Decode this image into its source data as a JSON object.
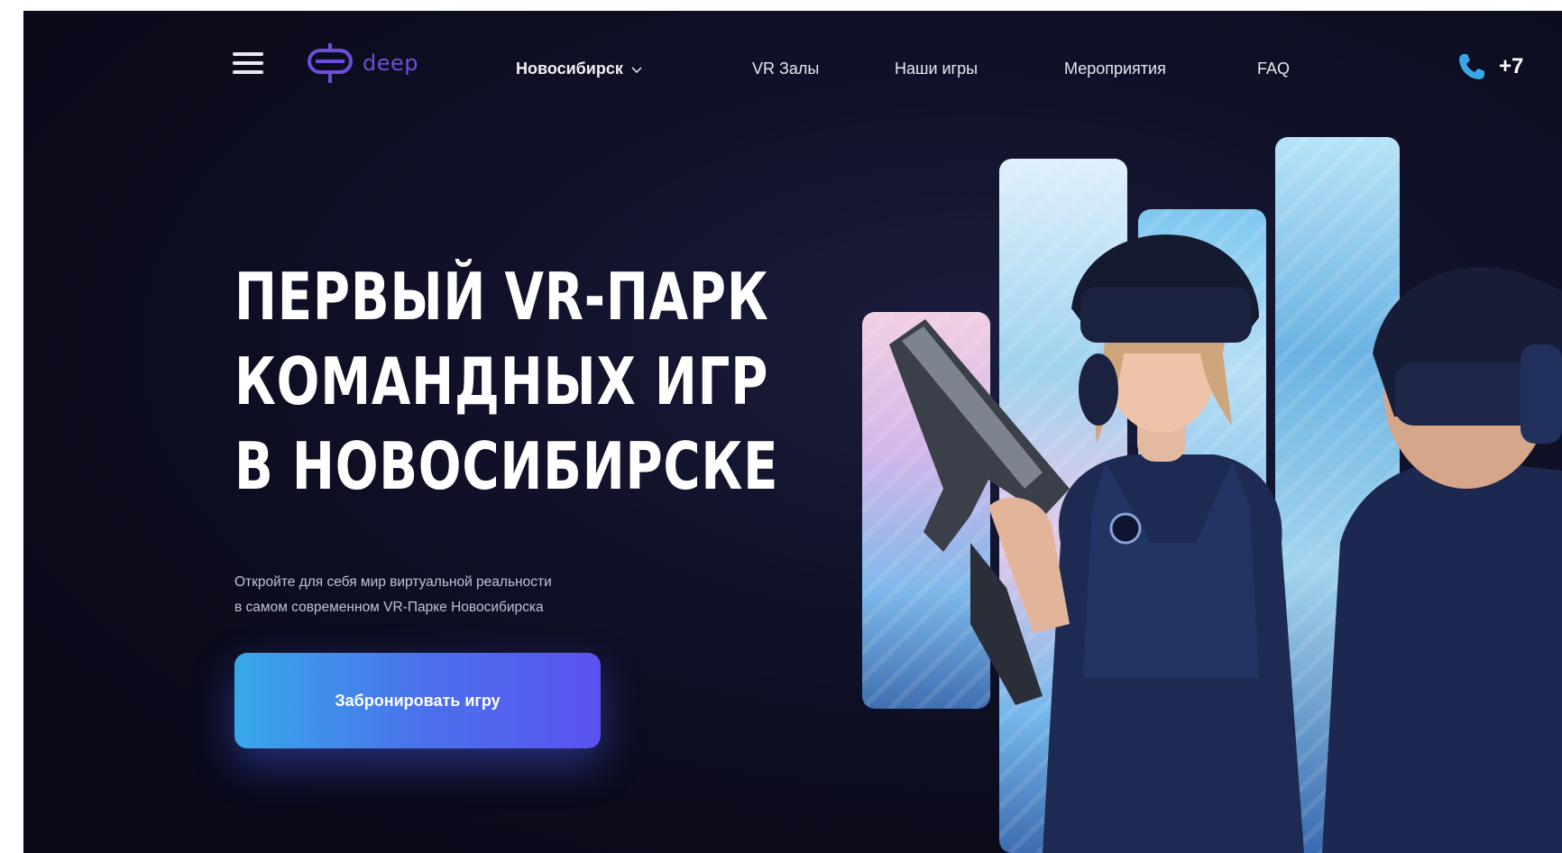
{
  "header": {
    "logo_text": "deep",
    "city": "Новосибирск",
    "nav": [
      {
        "label": "VR Залы"
      },
      {
        "label": "Наши игры"
      },
      {
        "label": "Мероприятия"
      },
      {
        "label": "FAQ"
      }
    ],
    "phone": "+7"
  },
  "hero": {
    "title_lines": [
      "ПЕРВЫЙ VR-ПАРК",
      "КОМАНДНЫХ ИГР",
      "В НОВОСИБИРСКЕ"
    ],
    "subtitle_lines": [
      "Откройте для себя мир виртуальной реальности",
      "в самом современном VR-Парке Новосибирска"
    ],
    "cta_label": "Забронировать игру"
  },
  "colors": {
    "background": "#0b0b1c",
    "accent_start": "#36a9ea",
    "accent_end": "#5a52ef",
    "logo": "#6b4fd9",
    "phone_icon": "#3aa7e8"
  },
  "icons": {
    "menu": "hamburger-icon",
    "logo": "deep-logo-icon",
    "city_dropdown": "chevron-down-icon",
    "phone": "phone-icon"
  }
}
